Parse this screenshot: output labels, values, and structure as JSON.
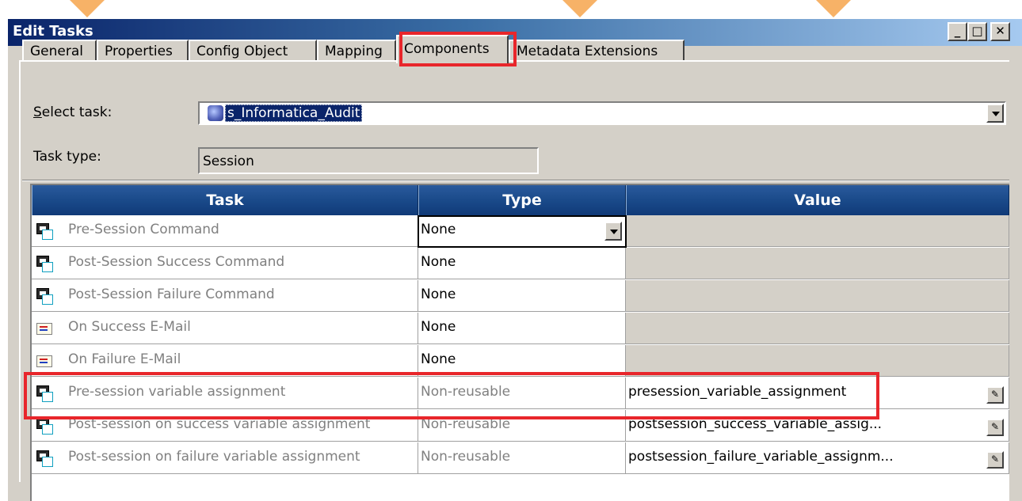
{
  "window": {
    "title": "Edit Tasks",
    "min_symbol": "_",
    "max_symbol": "□",
    "close_symbol": "✕"
  },
  "tabs": [
    {
      "label": "General",
      "active": false
    },
    {
      "label": "Properties",
      "active": false
    },
    {
      "label": "Config Object",
      "active": false
    },
    {
      "label": "Mapping",
      "active": false
    },
    {
      "label": "Components",
      "active": true
    },
    {
      "label": "Metadata Extensions",
      "active": false
    }
  ],
  "form": {
    "select_task_label_u": "S",
    "select_task_label_rest": "elect task:",
    "select_task_value": "s_Informatica_Audit",
    "task_type_label": "Task type:",
    "task_type_value": "Session"
  },
  "grid": {
    "columns": [
      "Task",
      "Type",
      "Value"
    ],
    "rows": [
      {
        "icon": "command-icon",
        "task": "Pre-Session Command",
        "type": "None",
        "value": "",
        "type_dropdown": true
      },
      {
        "icon": "command-icon",
        "task": "Post-Session Success Command",
        "type": "None",
        "value": ""
      },
      {
        "icon": "command-icon",
        "task": "Post-Session Failure Command",
        "type": "None",
        "value": ""
      },
      {
        "icon": "email-icon",
        "task": "On Success E-Mail",
        "type": "None",
        "value": ""
      },
      {
        "icon": "email-icon",
        "task": "On Failure E-Mail",
        "type": "None",
        "value": ""
      },
      {
        "icon": "command-icon",
        "task": "Pre-session variable assignment",
        "type": "Non-reusable",
        "value": "presession_variable_assignment",
        "highlighted": true
      },
      {
        "icon": "command-icon",
        "task": "Post-session on success variable assignment",
        "type": "Non-reusable",
        "value": "postsession_success_variable_assig..."
      },
      {
        "icon": "command-icon",
        "task": "Post-session on failure variable assignment",
        "type": "Non-reusable",
        "value": "postsession_failure_variable_assignm..."
      }
    ]
  },
  "colors": {
    "header_blue": "#1a4a8a",
    "highlight_red": "#e8262b",
    "dialog_grey": "#d4d0c8"
  }
}
